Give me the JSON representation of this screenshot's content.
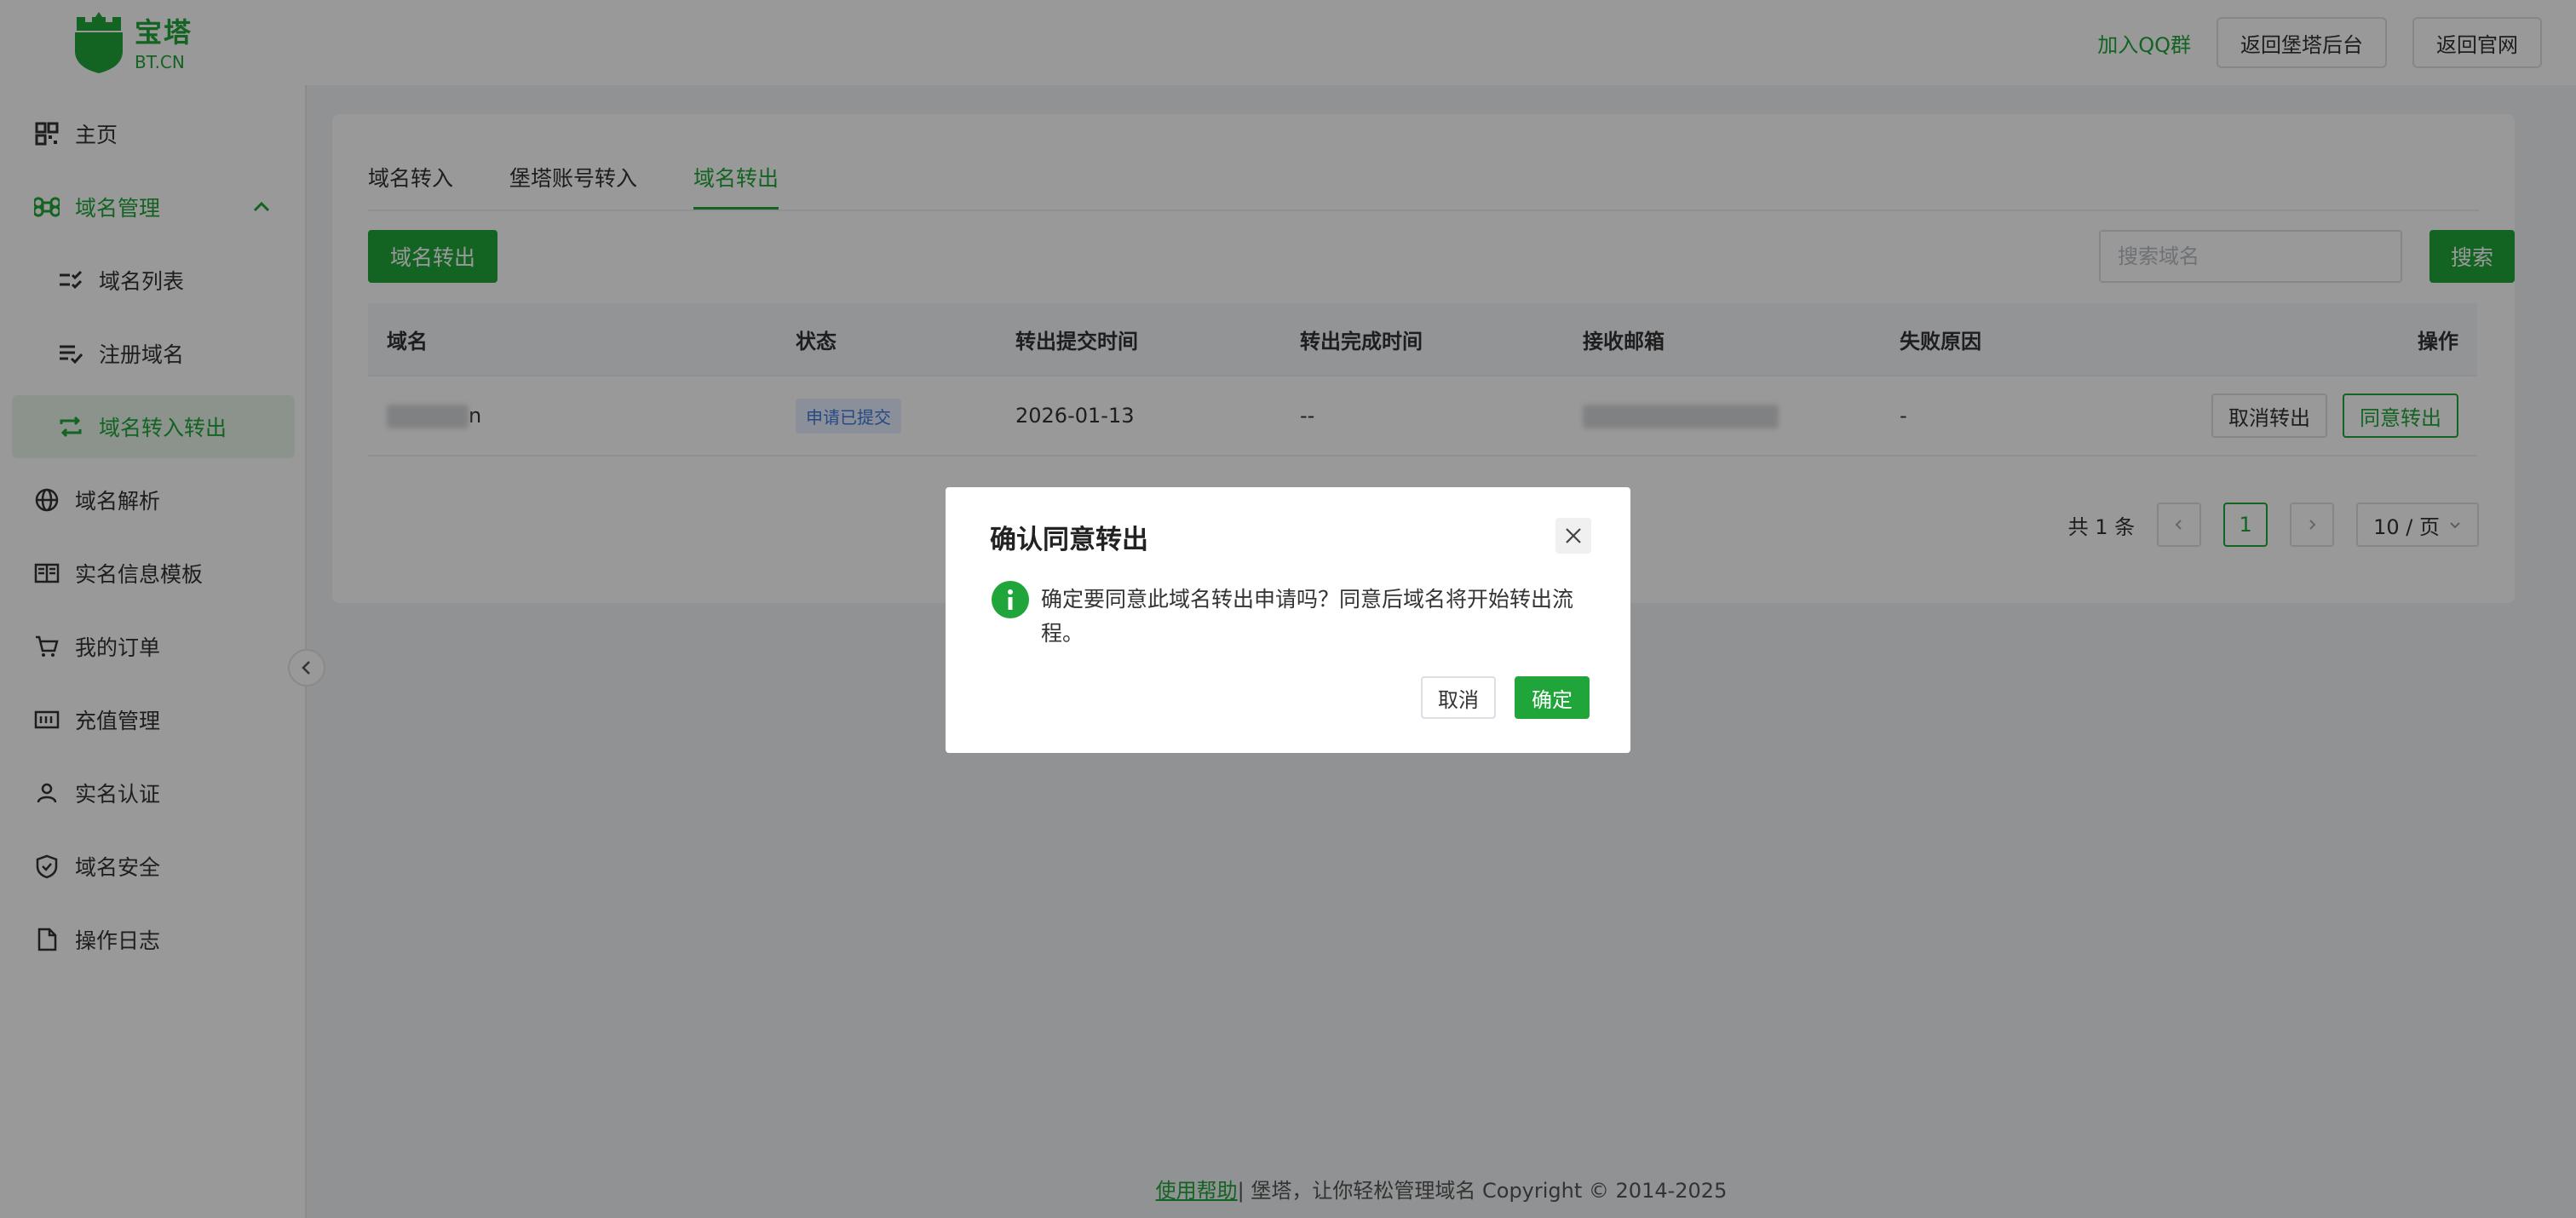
{
  "header": {
    "logo_cn": "宝塔",
    "logo_en": "BT.CN",
    "qq_link": "加入QQ群",
    "back_panel": "返回堡塔后台",
    "back_site": "返回官网"
  },
  "sidebar": {
    "items": [
      {
        "label": "主页",
        "icon": "grid-icon"
      },
      {
        "label": "域名管理",
        "icon": "command-icon"
      },
      {
        "label": "域名列表",
        "icon": "list-check-icon"
      },
      {
        "label": "注册域名",
        "icon": "list-edit-icon"
      },
      {
        "label": "域名转入转出",
        "icon": "transfer-icon"
      },
      {
        "label": "域名解析",
        "icon": "globe-icon"
      },
      {
        "label": "实名信息模板",
        "icon": "book-icon"
      },
      {
        "label": "我的订单",
        "icon": "cart-icon"
      },
      {
        "label": "充值管理",
        "icon": "wallet-icon"
      },
      {
        "label": "实名认证",
        "icon": "user-icon"
      },
      {
        "label": "域名安全",
        "icon": "shield-icon"
      },
      {
        "label": "操作日志",
        "icon": "file-icon"
      }
    ]
  },
  "main": {
    "tabs": [
      "域名转入",
      "堡塔账号转入",
      "域名转出"
    ],
    "transfer_out_button": "域名转出",
    "search_placeholder": "搜索域名",
    "search_button": "搜索",
    "table": {
      "headers": [
        "域名",
        "状态",
        "转出提交时间",
        "转出完成时间",
        "接收邮箱",
        "失败原因",
        "操作"
      ],
      "rows": [
        {
          "domain_suffix": "n",
          "status": "申请已提交",
          "submit_time": "2026-01-13",
          "complete_time": "--",
          "fail_reason": "-",
          "cancel_action": "取消转出",
          "agree_action": "同意转出"
        }
      ]
    },
    "pagination": {
      "total": "共 1 条",
      "current_page": "1",
      "page_size": "10 / 页"
    }
  },
  "footer": {
    "help_link": "使用帮助",
    "text": " | 堡塔，让你轻松管理域名 Copyright © 2014-2025"
  },
  "modal": {
    "title": "确认同意转出",
    "message": "确定要同意此域名转出申请吗？同意后域名将开始转出流程。",
    "cancel": "取消",
    "ok": "确定"
  },
  "colors": {
    "brand": "#20a53a",
    "tag_bg": "#e7efff",
    "tag_text": "#3f7ad9"
  }
}
